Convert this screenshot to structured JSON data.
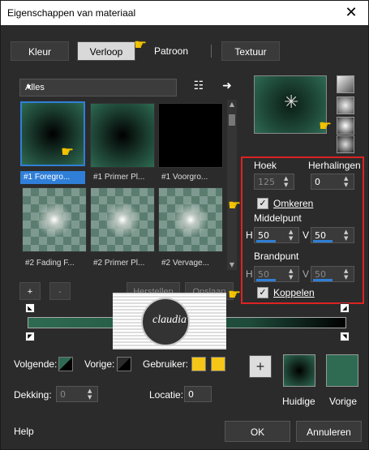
{
  "window": {
    "title": "Eigenschappen van materiaal",
    "close_label": "✕"
  },
  "tabs": [
    {
      "label": "Kleur"
    },
    {
      "label": "Verloop"
    },
    {
      "label": "Patroon"
    },
    {
      "label": "Textuur"
    }
  ],
  "gallery": {
    "filter_value": "Alles",
    "items": [
      {
        "label": "#1 Foregro..."
      },
      {
        "label": "#1 Primer Pl..."
      },
      {
        "label": "#1 Voorgro..."
      },
      {
        "label": "#2 Fading F..."
      },
      {
        "label": "#2 Primer Pl..."
      },
      {
        "label": "#2 Vervage..."
      }
    ]
  },
  "buttons": {
    "add": "+",
    "remove": "-",
    "reset": "Herstellen",
    "save": "Opslaan"
  },
  "props": {
    "angle_label": "Hoek",
    "angle_value": "125",
    "repeats_label": "Herhalingen",
    "repeats_value": "0",
    "invert_label": "Omkeren",
    "midpoint_label": "Middelpunt",
    "mid_h_label": "H",
    "mid_h_value": "50",
    "mid_v_label": "V",
    "mid_v_value": "50",
    "focal_label": "Brandpunt",
    "focal_h_label": "H",
    "focal_h_value": "50",
    "focal_v_label": "V",
    "focal_v_value": "50",
    "link_label": "Koppelen"
  },
  "watermark": {
    "text": "claudia"
  },
  "bottom": {
    "next_label": "Volgende:",
    "prev_label": "Vorige:",
    "user_label": "Gebruiker:",
    "opacity_label": "Dekking:",
    "opacity_value": "0",
    "location_label": "Locatie:",
    "location_value": "0",
    "add_symbol": "+",
    "current_label": "Huidige",
    "previous_label": "Vorige"
  },
  "footer": {
    "help": "Help",
    "ok": "OK",
    "cancel": "Annuleren"
  },
  "colors": {
    "accent": "#2f7fd8",
    "gradient_start": "#2e6b52",
    "gradient_end": "#000000",
    "user_swatch": "#f5c518",
    "highlight_box": "#dd2222"
  }
}
